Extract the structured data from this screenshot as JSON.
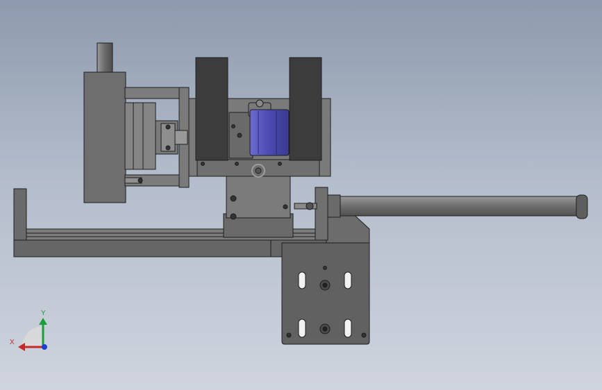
{
  "viewport": {
    "background_top": "#8d9aad",
    "background_bottom": "#cfd4de"
  },
  "model": {
    "part_fill_dark": "#5f5f5f",
    "part_fill_mid": "#7a7a7a",
    "part_fill_light": "#8c8c8c",
    "pad_fill": "#3c3c3c",
    "motor_fill": "#4a4ab0",
    "edge_color": "#1e1e1e"
  },
  "triad": {
    "x_label": "X",
    "y_label": "Y",
    "x_color": "#c62828",
    "y_color": "#1b9e3a",
    "z_color": "#1a3fd6"
  }
}
